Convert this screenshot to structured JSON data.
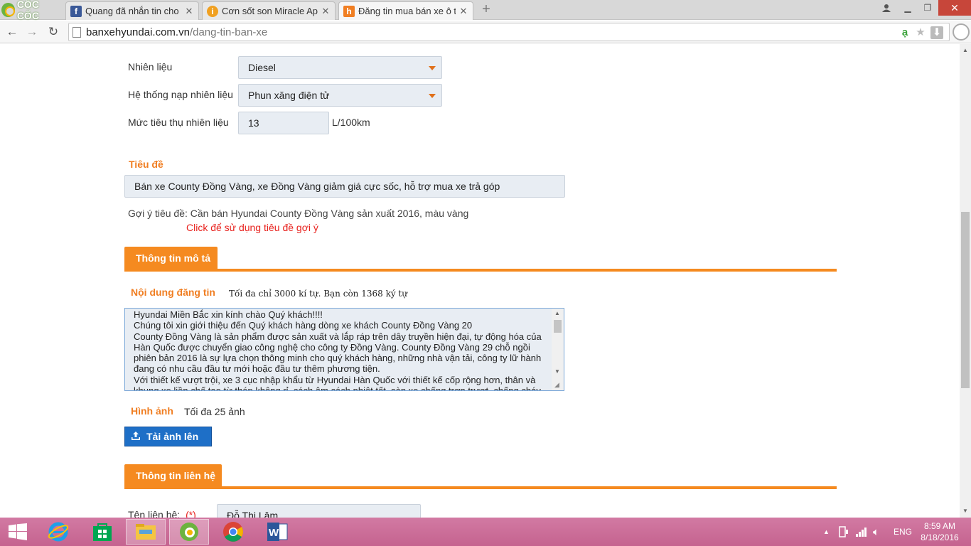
{
  "browser": {
    "logo_text": "CỐC CỐC",
    "tabs": [
      {
        "title": "Quang đã nhắn tin cho bạ",
        "favicon": "facebook-icon",
        "favicon_color": "#3b5998"
      },
      {
        "title": "Cơn sốt son Miracle Apo C",
        "favicon": "info-circle-icon",
        "favicon_color": "#f0a020"
      },
      {
        "title": "Đăng tin mua bán xe ô tô",
        "favicon": "h-logo-icon",
        "favicon_color": "#f07e22"
      }
    ],
    "url_host": "banxehyundai.com.vn",
    "url_path": "/dang-tin-ban-xe"
  },
  "form": {
    "fuel": {
      "label": "Nhiên liệu",
      "value": "Diesel"
    },
    "fuel_system": {
      "label": "Hệ thống nạp nhiên liệu",
      "value": "Phun xăng điện tử"
    },
    "consumption": {
      "label": "Mức tiêu thụ nhiên liệu",
      "value": "13",
      "unit": "L/100km"
    },
    "title_section": {
      "heading": "Tiêu đề",
      "value": "Bán xe County Đồng Vàng, xe Đồng Vàng giảm giá cực sốc, hỗ trợ mua xe trả góp",
      "suggest_label": "Gợi ý tiêu đề:",
      "suggest_value": "Cần bán Hyundai County Đồng Vàng sản xuất 2016, màu vàng",
      "suggest_link": "Click để sử dụng tiêu đề gợi ý"
    },
    "description_section": {
      "tab": "Thông tin mô tả",
      "content_heading": "Nội dung đăng tin",
      "limit_note": "Tối đa chỉ 3000 kí tự. Bạn còn 1368 ký tự",
      "content": "Hyundai Miền Bắc xin kính chào Quý khách!!!!\nChúng tôi xin giới thiệu đến Quý khách hàng dòng xe khách County Đồng Vàng 20\nCounty Đồng Vàng là sản phẩm được sản xuất và lắp ráp trên dây truyền hiện đại, tự động hóa của Hàn Quốc được chuyển giao công nghệ cho công ty Đồng Vàng. County Đồng Vàng 29 chỗ ngồi phiên bản 2016 là sự lựa chọn thông minh cho quý khách hàng, những nhà vận tải, công ty lữ hành đang có nhu cầu đầu tư mới hoặc đầu tư thêm phương tiện.\nVới thiết kế vượt trội, xe 3 cục nhập khẩu từ Hyundai Hàn Quốc với thiết kế cốp rộng hơn, thân và khung xe liền chế tạo từ thép không rỉ, cách âm cách nhiệt tốt, sàn xe chống trơn trượt, chống cháy",
      "images_heading": "Hình ảnh",
      "images_note": "Tối đa 25 ảnh",
      "upload_label": "Tải ảnh lên"
    },
    "contact_section": {
      "tab": "Thông tin liên hệ",
      "name_label": "Tên liên hệ:",
      "required_mark": "(*)",
      "name_value": "Đỗ Thị Lâm"
    }
  },
  "taskbar": {
    "language": "ENG",
    "time": "8:59 AM",
    "date": "8/18/2016"
  },
  "colors": {
    "accent_orange": "#f58a20",
    "link_red": "#e8221e",
    "taskbar": "#cc6f9a",
    "upload_blue": "#1e6fc7"
  }
}
